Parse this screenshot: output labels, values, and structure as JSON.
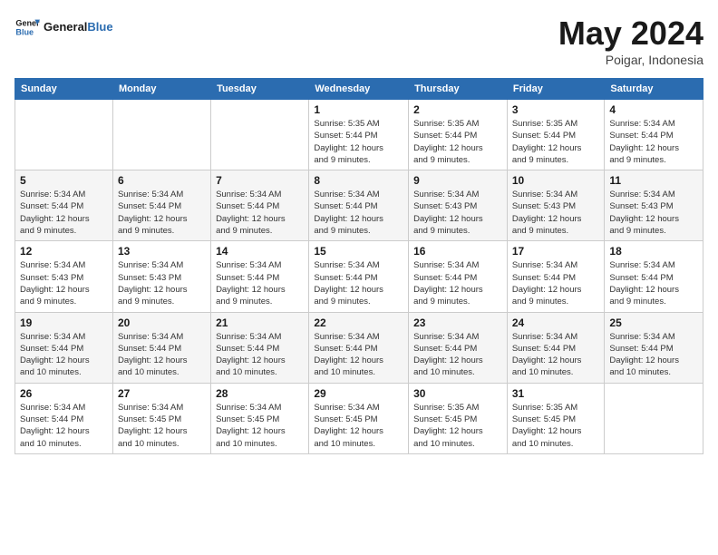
{
  "logo": {
    "text_general": "General",
    "text_blue": "Blue"
  },
  "header": {
    "month_year": "May 2024",
    "location": "Poigar, Indonesia"
  },
  "weekdays": [
    "Sunday",
    "Monday",
    "Tuesday",
    "Wednesday",
    "Thursday",
    "Friday",
    "Saturday"
  ],
  "weeks": [
    [
      {
        "day": "",
        "info": ""
      },
      {
        "day": "",
        "info": ""
      },
      {
        "day": "",
        "info": ""
      },
      {
        "day": "1",
        "info": "Sunrise: 5:35 AM\nSunset: 5:44 PM\nDaylight: 12 hours\nand 9 minutes."
      },
      {
        "day": "2",
        "info": "Sunrise: 5:35 AM\nSunset: 5:44 PM\nDaylight: 12 hours\nand 9 minutes."
      },
      {
        "day": "3",
        "info": "Sunrise: 5:35 AM\nSunset: 5:44 PM\nDaylight: 12 hours\nand 9 minutes."
      },
      {
        "day": "4",
        "info": "Sunrise: 5:34 AM\nSunset: 5:44 PM\nDaylight: 12 hours\nand 9 minutes."
      }
    ],
    [
      {
        "day": "5",
        "info": "Sunrise: 5:34 AM\nSunset: 5:44 PM\nDaylight: 12 hours\nand 9 minutes."
      },
      {
        "day": "6",
        "info": "Sunrise: 5:34 AM\nSunset: 5:44 PM\nDaylight: 12 hours\nand 9 minutes."
      },
      {
        "day": "7",
        "info": "Sunrise: 5:34 AM\nSunset: 5:44 PM\nDaylight: 12 hours\nand 9 minutes."
      },
      {
        "day": "8",
        "info": "Sunrise: 5:34 AM\nSunset: 5:44 PM\nDaylight: 12 hours\nand 9 minutes."
      },
      {
        "day": "9",
        "info": "Sunrise: 5:34 AM\nSunset: 5:43 PM\nDaylight: 12 hours\nand 9 minutes."
      },
      {
        "day": "10",
        "info": "Sunrise: 5:34 AM\nSunset: 5:43 PM\nDaylight: 12 hours\nand 9 minutes."
      },
      {
        "day": "11",
        "info": "Sunrise: 5:34 AM\nSunset: 5:43 PM\nDaylight: 12 hours\nand 9 minutes."
      }
    ],
    [
      {
        "day": "12",
        "info": "Sunrise: 5:34 AM\nSunset: 5:43 PM\nDaylight: 12 hours\nand 9 minutes."
      },
      {
        "day": "13",
        "info": "Sunrise: 5:34 AM\nSunset: 5:43 PM\nDaylight: 12 hours\nand 9 minutes."
      },
      {
        "day": "14",
        "info": "Sunrise: 5:34 AM\nSunset: 5:44 PM\nDaylight: 12 hours\nand 9 minutes."
      },
      {
        "day": "15",
        "info": "Sunrise: 5:34 AM\nSunset: 5:44 PM\nDaylight: 12 hours\nand 9 minutes."
      },
      {
        "day": "16",
        "info": "Sunrise: 5:34 AM\nSunset: 5:44 PM\nDaylight: 12 hours\nand 9 minutes."
      },
      {
        "day": "17",
        "info": "Sunrise: 5:34 AM\nSunset: 5:44 PM\nDaylight: 12 hours\nand 9 minutes."
      },
      {
        "day": "18",
        "info": "Sunrise: 5:34 AM\nSunset: 5:44 PM\nDaylight: 12 hours\nand 9 minutes."
      }
    ],
    [
      {
        "day": "19",
        "info": "Sunrise: 5:34 AM\nSunset: 5:44 PM\nDaylight: 12 hours\nand 10 minutes."
      },
      {
        "day": "20",
        "info": "Sunrise: 5:34 AM\nSunset: 5:44 PM\nDaylight: 12 hours\nand 10 minutes."
      },
      {
        "day": "21",
        "info": "Sunrise: 5:34 AM\nSunset: 5:44 PM\nDaylight: 12 hours\nand 10 minutes."
      },
      {
        "day": "22",
        "info": "Sunrise: 5:34 AM\nSunset: 5:44 PM\nDaylight: 12 hours\nand 10 minutes."
      },
      {
        "day": "23",
        "info": "Sunrise: 5:34 AM\nSunset: 5:44 PM\nDaylight: 12 hours\nand 10 minutes."
      },
      {
        "day": "24",
        "info": "Sunrise: 5:34 AM\nSunset: 5:44 PM\nDaylight: 12 hours\nand 10 minutes."
      },
      {
        "day": "25",
        "info": "Sunrise: 5:34 AM\nSunset: 5:44 PM\nDaylight: 12 hours\nand 10 minutes."
      }
    ],
    [
      {
        "day": "26",
        "info": "Sunrise: 5:34 AM\nSunset: 5:44 PM\nDaylight: 12 hours\nand 10 minutes."
      },
      {
        "day": "27",
        "info": "Sunrise: 5:34 AM\nSunset: 5:45 PM\nDaylight: 12 hours\nand 10 minutes."
      },
      {
        "day": "28",
        "info": "Sunrise: 5:34 AM\nSunset: 5:45 PM\nDaylight: 12 hours\nand 10 minutes."
      },
      {
        "day": "29",
        "info": "Sunrise: 5:34 AM\nSunset: 5:45 PM\nDaylight: 12 hours\nand 10 minutes."
      },
      {
        "day": "30",
        "info": "Sunrise: 5:35 AM\nSunset: 5:45 PM\nDaylight: 12 hours\nand 10 minutes."
      },
      {
        "day": "31",
        "info": "Sunrise: 5:35 AM\nSunset: 5:45 PM\nDaylight: 12 hours\nand 10 minutes."
      },
      {
        "day": "",
        "info": ""
      }
    ]
  ]
}
